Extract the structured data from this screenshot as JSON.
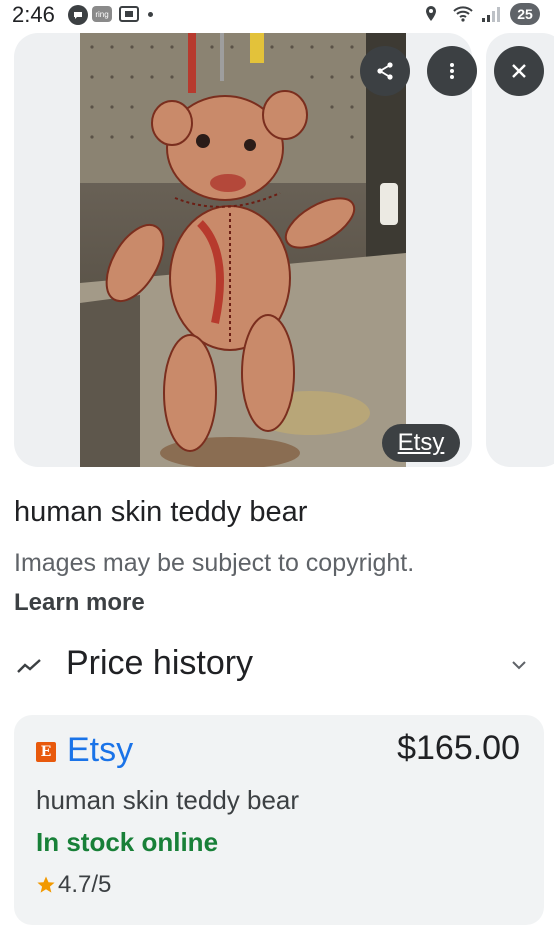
{
  "status_bar": {
    "time": "2:46",
    "ring_label": "ring",
    "battery_level": "25"
  },
  "image": {
    "source_label": "Etsy"
  },
  "result": {
    "title": "human skin teddy bear",
    "copyright_note": "Images may be subject to copyright.",
    "learn_more": "Learn more"
  },
  "price_history": {
    "label": "Price history"
  },
  "offer": {
    "merchant_logo_letter": "E",
    "merchant": "Etsy",
    "price": "$165.00",
    "product_name": "human skin teddy bear",
    "stock_status": "In stock online",
    "rating": "4.7/5"
  },
  "colors": {
    "link_blue": "#1a73e8",
    "stock_green": "#188038",
    "star_gold": "#f29900",
    "overlay_button": "#3c4043"
  },
  "icons": [
    "chat-bubble-icon",
    "ring-app-icon",
    "cast-icon",
    "location-icon",
    "wifi-icon",
    "signal-icon",
    "share-icon",
    "more-vert-icon",
    "close-icon",
    "trend-icon",
    "chevron-down-icon",
    "star-icon"
  ]
}
